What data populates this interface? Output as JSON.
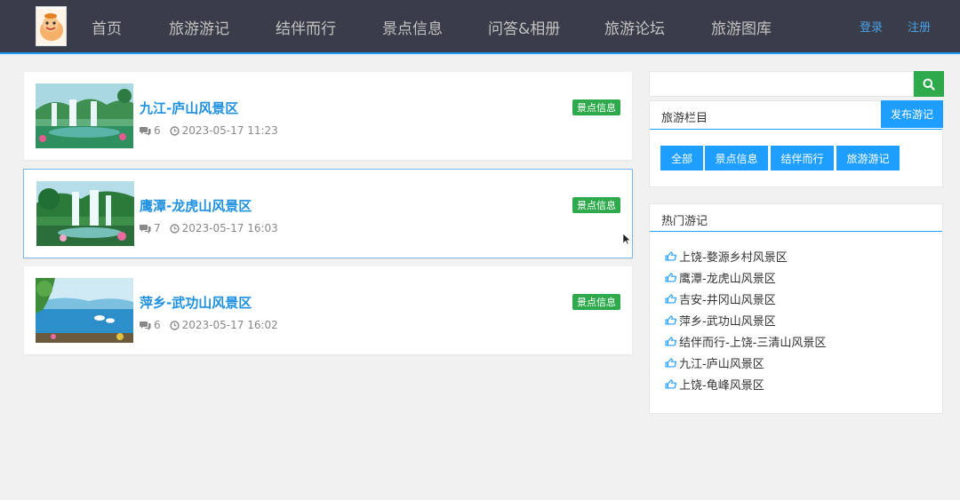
{
  "nav": {
    "items": [
      "首页",
      "旅游游记",
      "结伴而行",
      "景点信息",
      "问答&相册",
      "旅游论坛",
      "旅游图库"
    ],
    "login": "登录",
    "register": "注册"
  },
  "articles": [
    {
      "title": "九江-庐山风景区",
      "comments": "6",
      "date": "2023-05-17 11:23",
      "tag": "景点信息"
    },
    {
      "title": "鹰潭-龙虎山风景区",
      "comments": "7",
      "date": "2023-05-17 16:03",
      "tag": "景点信息"
    },
    {
      "title": "萍乡-武功山风景区",
      "comments": "6",
      "date": "2023-05-17 16:02",
      "tag": "景点信息"
    }
  ],
  "search": {
    "placeholder": ""
  },
  "category_panel": {
    "title": "旅游栏目",
    "publish": "发布游记",
    "buttons": [
      "全部",
      "景点信息",
      "结伴而行",
      "旅游游记"
    ]
  },
  "hot_panel": {
    "title": "热门游记",
    "items": [
      "上饶-婺源乡村风景区",
      "鹰潭-龙虎山风景区",
      "吉安-井冈山风景区",
      "萍乡-武功山风景区",
      "结伴而行-上饶-三清山风景区",
      "九江-庐山风景区",
      "上饶-龟峰风景区"
    ]
  },
  "colors": {
    "nav_bg": "#393d49",
    "accent": "#1e9fff",
    "tag": "#2eaa4d",
    "title": "#1e90e0"
  }
}
